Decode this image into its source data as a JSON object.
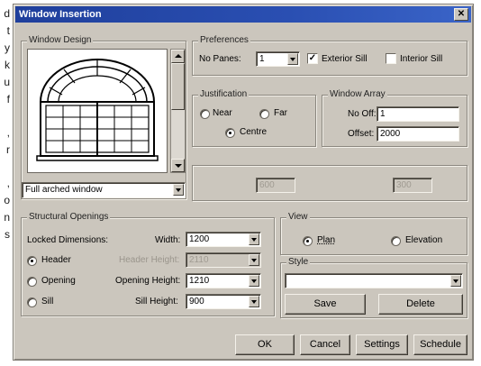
{
  "background_text": [
    "d",
    "t",
    "y",
    "k",
    "u",
    "f",
    ",",
    "r",
    ",",
    "o",
    "n",
    "s"
  ],
  "window": {
    "title": "Window Insertion",
    "close_glyph": "✕"
  },
  "window_design": {
    "legend": "Window Design",
    "type_value": "Full arched window",
    "preview_icon": "full-arched-window-icon",
    "value_a": "600",
    "value_b": "300"
  },
  "preferences": {
    "legend": "Preferences",
    "no_panes_label": "No Panes:",
    "no_panes_value": "1",
    "exterior_sill_label": "Exterior Sill",
    "exterior_sill_checked": true,
    "interior_sill_label": "Interior Sill",
    "interior_sill_checked": false
  },
  "justification": {
    "legend": "Justification",
    "options": [
      {
        "label": "Near",
        "selected": false
      },
      {
        "label": "Far",
        "selected": false
      },
      {
        "label": "Centre",
        "selected": true
      }
    ]
  },
  "window_array": {
    "legend": "Window Array",
    "no_off_label": "No Off:",
    "no_off_value": "1",
    "offset_label": "Offset:",
    "offset_value": "2000"
  },
  "structural_openings": {
    "legend": "Structural Openings",
    "locked_dimensions_label": "Locked Dimensions:",
    "width_label": "Width:",
    "width_value": "1200",
    "header_radio": {
      "label": "Header",
      "selected": true
    },
    "header_height_label": "Header Height:",
    "header_height_value": "2110",
    "opening_radio": {
      "label": "Opening",
      "selected": false
    },
    "opening_height_label": "Opening Height:",
    "opening_height_value": "1210",
    "sill_radio": {
      "label": "Sill",
      "selected": false
    },
    "sill_height_label": "Sill Height:",
    "sill_height_value": "900"
  },
  "view": {
    "legend": "View",
    "plan_label": "Plan",
    "plan_selected": true,
    "elevation_label": "Elevation",
    "elevation_selected": false
  },
  "style": {
    "legend": "Style",
    "value": "",
    "save_label": "Save",
    "delete_label": "Delete"
  },
  "buttons": {
    "ok": "OK",
    "cancel": "Cancel",
    "settings": "Settings",
    "schedule": "Schedule"
  },
  "colors": {
    "titlebar": "#1f3f9c",
    "dialog_face": "#cbc6bd"
  }
}
